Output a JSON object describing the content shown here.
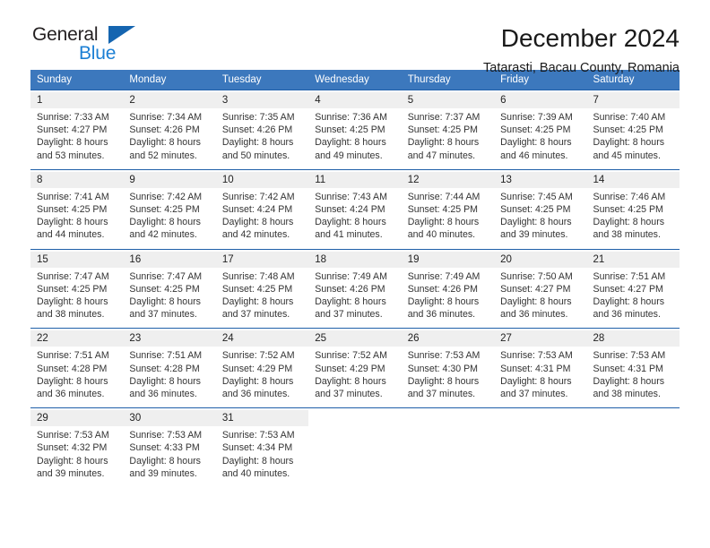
{
  "brand": {
    "line1": "General",
    "line2": "Blue",
    "triangle_color": "#1565b0"
  },
  "header": {
    "title": "December 2024",
    "subtitle": "Tatarasti, Bacau County, Romania"
  },
  "theme": {
    "header_bg": "#3c78bd",
    "week_separator": "#1f5fa8",
    "daynum_bg": "#efefef"
  },
  "weekdays": [
    "Sunday",
    "Monday",
    "Tuesday",
    "Wednesday",
    "Thursday",
    "Friday",
    "Saturday"
  ],
  "weeks": [
    {
      "days": [
        {
          "num": "1",
          "sunrise": "Sunrise: 7:33 AM",
          "sunset": "Sunset: 4:27 PM",
          "daylight1": "Daylight: 8 hours",
          "daylight2": "and 53 minutes."
        },
        {
          "num": "2",
          "sunrise": "Sunrise: 7:34 AM",
          "sunset": "Sunset: 4:26 PM",
          "daylight1": "Daylight: 8 hours",
          "daylight2": "and 52 minutes."
        },
        {
          "num": "3",
          "sunrise": "Sunrise: 7:35 AM",
          "sunset": "Sunset: 4:26 PM",
          "daylight1": "Daylight: 8 hours",
          "daylight2": "and 50 minutes."
        },
        {
          "num": "4",
          "sunrise": "Sunrise: 7:36 AM",
          "sunset": "Sunset: 4:25 PM",
          "daylight1": "Daylight: 8 hours",
          "daylight2": "and 49 minutes."
        },
        {
          "num": "5",
          "sunrise": "Sunrise: 7:37 AM",
          "sunset": "Sunset: 4:25 PM",
          "daylight1": "Daylight: 8 hours",
          "daylight2": "and 47 minutes."
        },
        {
          "num": "6",
          "sunrise": "Sunrise: 7:39 AM",
          "sunset": "Sunset: 4:25 PM",
          "daylight1": "Daylight: 8 hours",
          "daylight2": "and 46 minutes."
        },
        {
          "num": "7",
          "sunrise": "Sunrise: 7:40 AM",
          "sunset": "Sunset: 4:25 PM",
          "daylight1": "Daylight: 8 hours",
          "daylight2": "and 45 minutes."
        }
      ]
    },
    {
      "days": [
        {
          "num": "8",
          "sunrise": "Sunrise: 7:41 AM",
          "sunset": "Sunset: 4:25 PM",
          "daylight1": "Daylight: 8 hours",
          "daylight2": "and 44 minutes."
        },
        {
          "num": "9",
          "sunrise": "Sunrise: 7:42 AM",
          "sunset": "Sunset: 4:25 PM",
          "daylight1": "Daylight: 8 hours",
          "daylight2": "and 42 minutes."
        },
        {
          "num": "10",
          "sunrise": "Sunrise: 7:42 AM",
          "sunset": "Sunset: 4:24 PM",
          "daylight1": "Daylight: 8 hours",
          "daylight2": "and 42 minutes."
        },
        {
          "num": "11",
          "sunrise": "Sunrise: 7:43 AM",
          "sunset": "Sunset: 4:24 PM",
          "daylight1": "Daylight: 8 hours",
          "daylight2": "and 41 minutes."
        },
        {
          "num": "12",
          "sunrise": "Sunrise: 7:44 AM",
          "sunset": "Sunset: 4:25 PM",
          "daylight1": "Daylight: 8 hours",
          "daylight2": "and 40 minutes."
        },
        {
          "num": "13",
          "sunrise": "Sunrise: 7:45 AM",
          "sunset": "Sunset: 4:25 PM",
          "daylight1": "Daylight: 8 hours",
          "daylight2": "and 39 minutes."
        },
        {
          "num": "14",
          "sunrise": "Sunrise: 7:46 AM",
          "sunset": "Sunset: 4:25 PM",
          "daylight1": "Daylight: 8 hours",
          "daylight2": "and 38 minutes."
        }
      ]
    },
    {
      "days": [
        {
          "num": "15",
          "sunrise": "Sunrise: 7:47 AM",
          "sunset": "Sunset: 4:25 PM",
          "daylight1": "Daylight: 8 hours",
          "daylight2": "and 38 minutes."
        },
        {
          "num": "16",
          "sunrise": "Sunrise: 7:47 AM",
          "sunset": "Sunset: 4:25 PM",
          "daylight1": "Daylight: 8 hours",
          "daylight2": "and 37 minutes."
        },
        {
          "num": "17",
          "sunrise": "Sunrise: 7:48 AM",
          "sunset": "Sunset: 4:25 PM",
          "daylight1": "Daylight: 8 hours",
          "daylight2": "and 37 minutes."
        },
        {
          "num": "18",
          "sunrise": "Sunrise: 7:49 AM",
          "sunset": "Sunset: 4:26 PM",
          "daylight1": "Daylight: 8 hours",
          "daylight2": "and 37 minutes."
        },
        {
          "num": "19",
          "sunrise": "Sunrise: 7:49 AM",
          "sunset": "Sunset: 4:26 PM",
          "daylight1": "Daylight: 8 hours",
          "daylight2": "and 36 minutes."
        },
        {
          "num": "20",
          "sunrise": "Sunrise: 7:50 AM",
          "sunset": "Sunset: 4:27 PM",
          "daylight1": "Daylight: 8 hours",
          "daylight2": "and 36 minutes."
        },
        {
          "num": "21",
          "sunrise": "Sunrise: 7:51 AM",
          "sunset": "Sunset: 4:27 PM",
          "daylight1": "Daylight: 8 hours",
          "daylight2": "and 36 minutes."
        }
      ]
    },
    {
      "days": [
        {
          "num": "22",
          "sunrise": "Sunrise: 7:51 AM",
          "sunset": "Sunset: 4:28 PM",
          "daylight1": "Daylight: 8 hours",
          "daylight2": "and 36 minutes."
        },
        {
          "num": "23",
          "sunrise": "Sunrise: 7:51 AM",
          "sunset": "Sunset: 4:28 PM",
          "daylight1": "Daylight: 8 hours",
          "daylight2": "and 36 minutes."
        },
        {
          "num": "24",
          "sunrise": "Sunrise: 7:52 AM",
          "sunset": "Sunset: 4:29 PM",
          "daylight1": "Daylight: 8 hours",
          "daylight2": "and 36 minutes."
        },
        {
          "num": "25",
          "sunrise": "Sunrise: 7:52 AM",
          "sunset": "Sunset: 4:29 PM",
          "daylight1": "Daylight: 8 hours",
          "daylight2": "and 37 minutes."
        },
        {
          "num": "26",
          "sunrise": "Sunrise: 7:53 AM",
          "sunset": "Sunset: 4:30 PM",
          "daylight1": "Daylight: 8 hours",
          "daylight2": "and 37 minutes."
        },
        {
          "num": "27",
          "sunrise": "Sunrise: 7:53 AM",
          "sunset": "Sunset: 4:31 PM",
          "daylight1": "Daylight: 8 hours",
          "daylight2": "and 37 minutes."
        },
        {
          "num": "28",
          "sunrise": "Sunrise: 7:53 AM",
          "sunset": "Sunset: 4:31 PM",
          "daylight1": "Daylight: 8 hours",
          "daylight2": "and 38 minutes."
        }
      ]
    },
    {
      "days": [
        {
          "num": "29",
          "sunrise": "Sunrise: 7:53 AM",
          "sunset": "Sunset: 4:32 PM",
          "daylight1": "Daylight: 8 hours",
          "daylight2": "and 39 minutes."
        },
        {
          "num": "30",
          "sunrise": "Sunrise: 7:53 AM",
          "sunset": "Sunset: 4:33 PM",
          "daylight1": "Daylight: 8 hours",
          "daylight2": "and 39 minutes."
        },
        {
          "num": "31",
          "sunrise": "Sunrise: 7:53 AM",
          "sunset": "Sunset: 4:34 PM",
          "daylight1": "Daylight: 8 hours",
          "daylight2": "and 40 minutes."
        },
        {
          "num": "",
          "sunrise": "",
          "sunset": "",
          "daylight1": "",
          "daylight2": ""
        },
        {
          "num": "",
          "sunrise": "",
          "sunset": "",
          "daylight1": "",
          "daylight2": ""
        },
        {
          "num": "",
          "sunrise": "",
          "sunset": "",
          "daylight1": "",
          "daylight2": ""
        },
        {
          "num": "",
          "sunrise": "",
          "sunset": "",
          "daylight1": "",
          "daylight2": ""
        }
      ]
    }
  ]
}
